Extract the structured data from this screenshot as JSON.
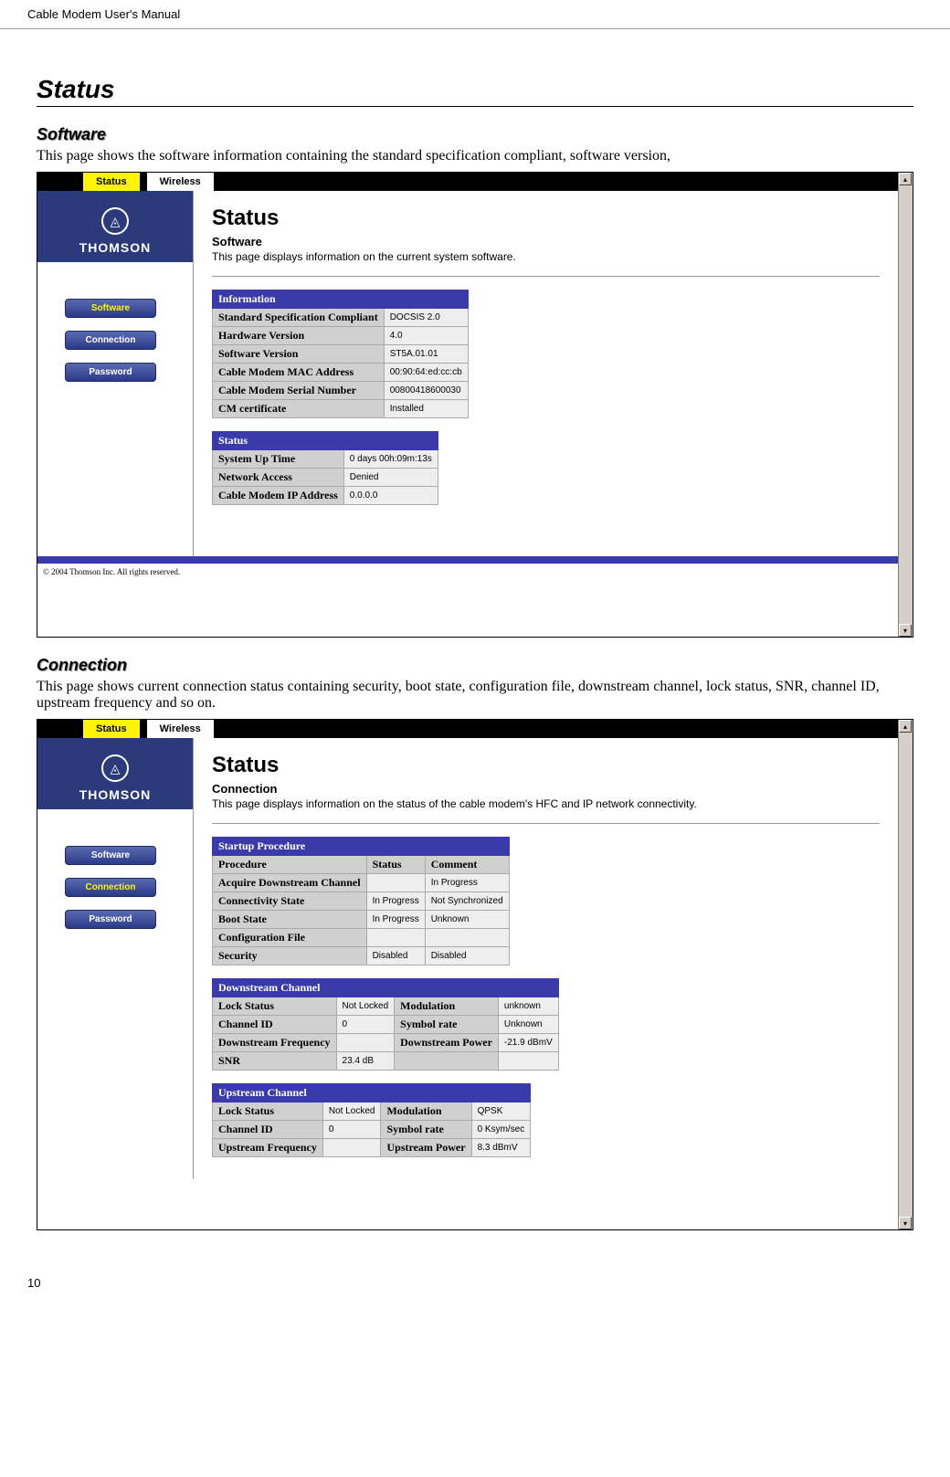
{
  "doc": {
    "header_title": "Cable Modem User's Manual",
    "page_number": "10",
    "h1": "Status",
    "section_software": {
      "heading": "Software",
      "body": "This page shows the software information containing the standard specification compliant, software version,"
    },
    "section_connection": {
      "heading": "Connection",
      "body": "This page shows current connection status containing security, boot state, configuration file, downstream channel, lock status, SNR, channel ID, upstream frequency and so on."
    }
  },
  "shot1": {
    "topnav": {
      "status": "Status",
      "wireless": "Wireless"
    },
    "brand": "THOMSON",
    "sidebar": {
      "software": "Software",
      "connection": "Connection",
      "password": "Password"
    },
    "title": "Status",
    "subtitle": "Software",
    "desc": "This page displays information on the current system software.",
    "info_header": "Information",
    "info_rows": {
      "r0l": "Standard Specification Compliant",
      "r0v": "DOCSIS 2.0",
      "r1l": "Hardware Version",
      "r1v": "4.0",
      "r2l": "Software Version",
      "r2v": "ST5A.01.01",
      "r3l": "Cable Modem MAC Address",
      "r3v": "00:90:64:ed:cc:cb",
      "r4l": "Cable Modem Serial Number",
      "r4v": "00800418600030",
      "r5l": "CM certificate",
      "r5v": "Installed"
    },
    "status_header": "Status",
    "status_rows": {
      "r0l": "System Up Time",
      "r0v": "0 days 00h:09m:13s",
      "r1l": "Network Access",
      "r1v": "Denied",
      "r2l": "Cable Modem IP Address",
      "r2v": "0.0.0.0"
    },
    "copyright": "© 2004  Thomson Inc.   All rights reserved."
  },
  "shot2": {
    "topnav": {
      "status": "Status",
      "wireless": "Wireless"
    },
    "brand": "THOMSON",
    "sidebar": {
      "software": "Software",
      "connection": "Connection",
      "password": "Password"
    },
    "title": "Status",
    "subtitle": "Connection",
    "desc": "This page displays information on the status of the cable modem's HFC and IP network connectivity.",
    "startup_header": "Startup Procedure",
    "startup_cols": {
      "c0": "Procedure",
      "c1": "Status",
      "c2": "Comment"
    },
    "startup_rows": {
      "r0c0": "Acquire Downstream Channel",
      "r0c1": "",
      "r0c2": "In Progress",
      "r1c0": "Connectivity State",
      "r1c1": "In Progress",
      "r1c2": "Not Synchronized",
      "r2c0": "Boot State",
      "r2c1": "In Progress",
      "r2c2": "Unknown",
      "r3c0": "Configuration File",
      "r3c1": "",
      "r3c2": "",
      "r4c0": "Security",
      "r4c1": "Disabled",
      "r4c2": "Disabled"
    },
    "down_header": "Downstream Channel",
    "down": {
      "r0c0": "Lock Status",
      "r0c1": "Not Locked",
      "r0c2": "Modulation",
      "r0c3": "unknown",
      "r1c0": "Channel ID",
      "r1c1": "0",
      "r1c2": "Symbol rate",
      "r1c3": "Unknown",
      "r2c0": "Downstream Frequency",
      "r2c1": "",
      "r2c2": "Downstream Power",
      "r2c3": "-21.9 dBmV",
      "r3c0": "SNR",
      "r3c1": "23.4 dB",
      "r3c2": "",
      "r3c3": ""
    },
    "up_header": "Upstream Channel",
    "up": {
      "r0c0": "Lock Status",
      "r0c1": "Not Locked",
      "r0c2": "Modulation",
      "r0c3": "QPSK",
      "r1c0": "Channel ID",
      "r1c1": "0",
      "r1c2": "Symbol rate",
      "r1c3": "0 Ksym/sec",
      "r2c0": "Upstream Frequency",
      "r2c1": "",
      "r2c2": "Upstream Power",
      "r2c3": "8.3 dBmV"
    }
  }
}
